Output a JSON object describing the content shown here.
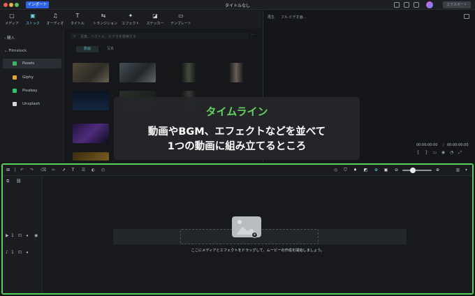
{
  "window": {
    "title": "タイトルなし",
    "import_label": "インポート",
    "export_label": "エクスポート"
  },
  "toolbar": {
    "items": [
      {
        "label": "メディア",
        "icon": "media-icon"
      },
      {
        "label": "ストック",
        "icon": "stock-icon",
        "active": true
      },
      {
        "label": "オーディオ",
        "icon": "music-note-icon"
      },
      {
        "label": "タイトル",
        "icon": "text-t-icon"
      },
      {
        "label": "トランジション",
        "icon": "transition-icon"
      },
      {
        "label": "エフェクト",
        "icon": "effects-icon"
      },
      {
        "label": "ステッカー",
        "icon": "sticker-icon"
      },
      {
        "label": "テンプレート",
        "icon": "template-icon"
      }
    ]
  },
  "sidebar": {
    "import_label": "購入",
    "group_label": "Filmstock",
    "items": [
      {
        "label": "Pexels",
        "color": "#3bb36b",
        "active": true
      },
      {
        "label": "Giphy",
        "color": "#e3a531"
      },
      {
        "label": "Pixabay",
        "color": "#2ec66b"
      },
      {
        "label": "Unsplash",
        "color": "#d8d8d8"
      }
    ]
  },
  "media": {
    "search_placeholder": "写真、ベクトル、ビデオを検索する",
    "tabs": [
      "動画",
      "写真"
    ]
  },
  "preview": {
    "label": "再生",
    "quality": "フル ビデオ画…",
    "current_time": "00:00:00:00",
    "separator": "/",
    "total_time": "00:00:00:00"
  },
  "timeline": {
    "drop_message": "ここにメディアとエフェクトをドラッグして、ムービーの作成を開始しましょう。",
    "video_track": "1",
    "audio_track": "1"
  },
  "callout": {
    "title": "タイムライン",
    "line1": "動画やBGM、エフェクトなどを並べて",
    "line2": "1つの動画に組み立てるところ"
  },
  "colors": {
    "accent": "#6fd0e6",
    "highlight": "#55d05a",
    "import_button": "#2f63e6"
  }
}
